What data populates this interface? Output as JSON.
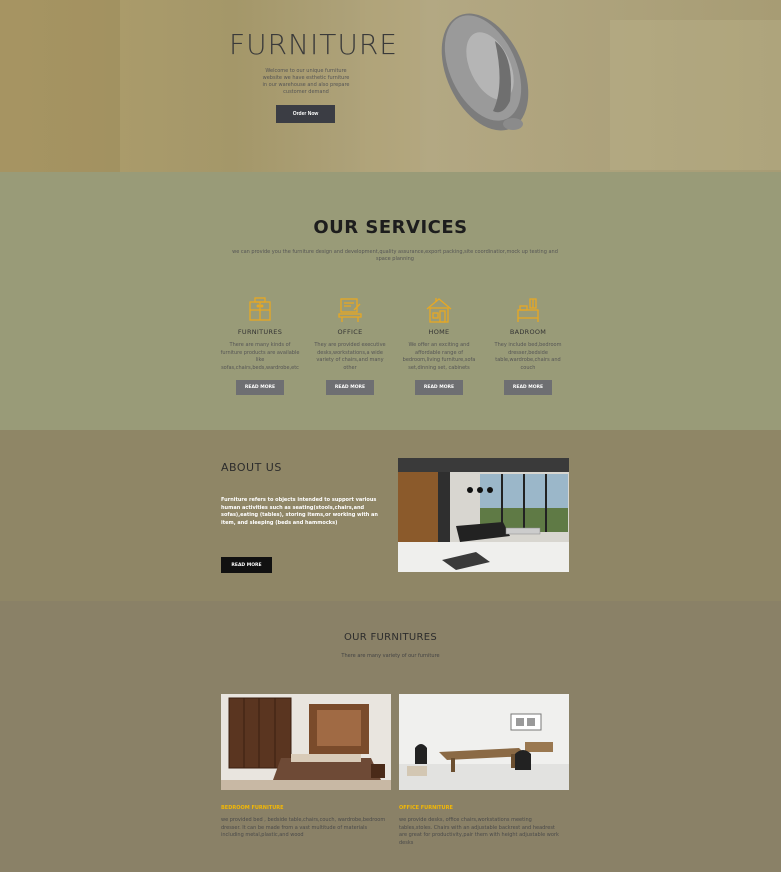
{
  "hero": {
    "title": "FURNITURE",
    "description": "Welcome to our unique furniture website we have esthetic furniture in our warehouse and also prepare customer demand",
    "order_button": "Order Now"
  },
  "services": {
    "title": "OUR SERVICES",
    "intro": "we can provide you the furniture design and development,quality assurance,export packing,site coordinatior,mock up testing and space planning",
    "items": [
      {
        "icon": "bedroom-cabinet-icon",
        "name": "FURNITURES",
        "desc": "There are many kinds of furniture products are available like sofas,chairs,beds,wardrobe,etc",
        "button": "READ MORE"
      },
      {
        "icon": "office-desk-icon",
        "name": "OFFICE",
        "desc": "They are provided executive desks,workstations,a wide variety of chairs,and many other",
        "button": "READ MORE"
      },
      {
        "icon": "home-furniture-icon",
        "name": "HOME",
        "desc": "We offer an exciting and affordable range of bedroom,living furniture,sofa set,dinning set, cabinets",
        "button": "READ MORE"
      },
      {
        "icon": "bedroom-icon",
        "name": "BADROOM",
        "desc": "They include bed,bedroom dresser,bedside table,wardrobe,chairs and couch",
        "button": "READ MORE"
      }
    ]
  },
  "about": {
    "title": "ABOUT US",
    "text": "Furniture refers to objects intended to support various human activities such as seating(stools,chairs,and sofas),eating (tables), storing items,or working with an item, and sleeping (beds and hammocks)",
    "button": "READ MORE"
  },
  "furnitures": {
    "title": "OUR FURNITURES",
    "subtitle": "There are many variety of our furniture",
    "cards": [
      {
        "title": "BEDROOM FURNITURE",
        "desc": "we provided bed , bedside table,chairs,couch, wardrobe,bedroom dresser. It can be made from a vast multitude of materials including metal,plastic,and wood"
      },
      {
        "title": "OFFICE FURNITURE",
        "desc": "we provide desks, office chairs,workstations meeting tables,stoles. Chairs with an adjustable backrest and headrest are great for productivity,pair them with height adjustable work desks"
      }
    ]
  },
  "colors": {
    "hero_bg": "#a89a6c",
    "services_bg": "#999b78",
    "about_bg": "#8f8666",
    "furnitures_bg": "#8a8167",
    "accent": "#f2b705",
    "icon": "#e7a823",
    "button_dark": "#3b3d44"
  }
}
